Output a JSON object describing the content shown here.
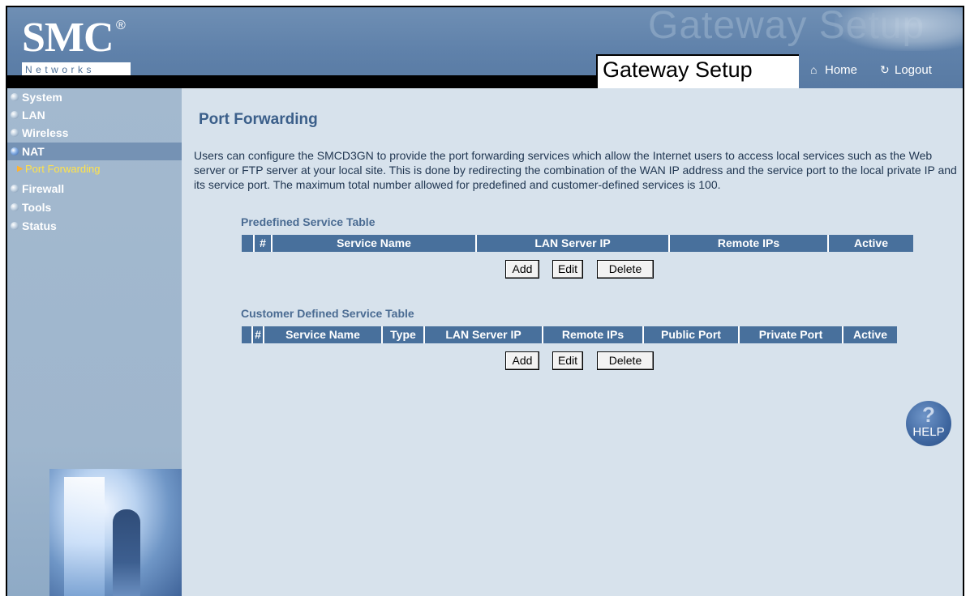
{
  "header": {
    "logo_text": "SMC",
    "logo_registered": "®",
    "logo_subtext": "Networks",
    "ghost_title": "Gateway Setup",
    "title": "Gateway Setup",
    "home_label": "Home",
    "logout_label": "Logout",
    "home_icon": "home-icon",
    "logout_icon": "logout-icon"
  },
  "sidebar": {
    "items": [
      {
        "label": "System"
      },
      {
        "label": "LAN"
      },
      {
        "label": "Wireless"
      },
      {
        "label": "NAT"
      },
      {
        "label": "Firewall"
      },
      {
        "label": "Tools"
      },
      {
        "label": "Status"
      }
    ],
    "active_index": 3,
    "subitems": [
      {
        "label": "Port Forwarding"
      }
    ]
  },
  "main": {
    "title": "Port Forwarding",
    "description": "Users can configure the SMCD3GN to provide the port forwarding services which allow the Internet users to access local services such as the Web server or FTP server at your local site. This is done by redirecting the combination of the WAN IP address and the service port to the local private IP and its service port. The maximum total number allowed for predefined and customer-defined services is 100.",
    "predefined": {
      "title": "Predefined Service Table",
      "headers": [
        "",
        "#",
        "Service Name",
        "LAN Server IP",
        "Remote IPs",
        "Active"
      ],
      "add_label": "Add",
      "edit_label": "Edit",
      "delete_label": "Delete"
    },
    "customer": {
      "title": "Customer Defined Service Table",
      "headers": [
        "",
        "#",
        "Service Name",
        "Type",
        "LAN Server IP",
        "Remote IPs",
        "Public Port",
        "Private Port",
        "Active"
      ],
      "add_label": "Add",
      "edit_label": "Edit",
      "delete_label": "Delete"
    },
    "help_label": "HELP"
  },
  "colors": {
    "header_blue": "#5f81aa",
    "sidebar_blue": "#a3b9cf",
    "content_bg": "#d7e2ec",
    "table_header": "#48709c",
    "title_blue": "#3b5f8a",
    "active_sub": "#ffe24a"
  }
}
